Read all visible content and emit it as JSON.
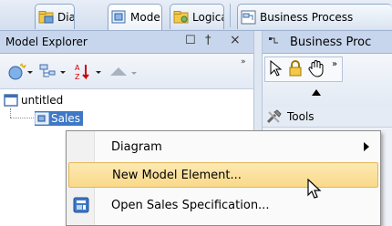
{
  "tabs": [
    {
      "label": "Diag..."
    },
    {
      "label": "Mode..."
    },
    {
      "label": "Logica..."
    },
    {
      "label": "Business Process"
    }
  ],
  "model_explorer": {
    "title": "Model Explorer",
    "pin_glyph": "☐",
    "dock_glyph": "†",
    "close_glyph": "×"
  },
  "tree": {
    "root_label": "untitled",
    "child_label": "Sales"
  },
  "right_pane": {
    "title": "Business Proc",
    "tools_label": "Tools"
  },
  "context_menu": {
    "items": [
      {
        "label": "Diagram",
        "has_submenu": true
      },
      {
        "label": "New Model Element...",
        "highlighted": true
      },
      {
        "label": "Open Sales Specification..."
      }
    ]
  },
  "colors": {
    "accent": "#3e78c6",
    "highlight": "#f9d98a",
    "panel_header": "#c7d6ec"
  }
}
